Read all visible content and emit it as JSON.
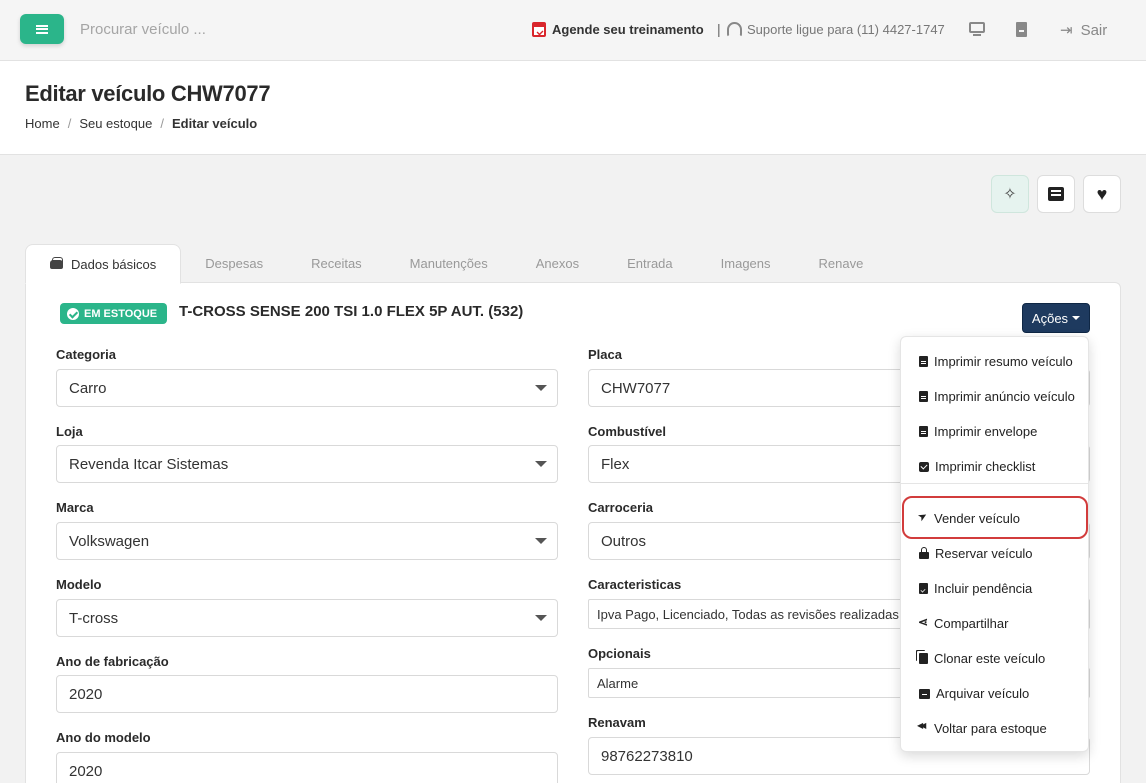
{
  "topbar": {
    "search_placeholder": "Procurar veículo ...",
    "training_label": "Agende seu treinamento",
    "separator": "|",
    "support_label": "Suporte ligue para (11) 4427-1747",
    "logout_label": "Sair"
  },
  "header": {
    "title": "Editar veículo CHW7077",
    "breadcrumb": [
      "Home",
      "Seu estoque",
      "Editar veículo"
    ],
    "breadcrumb_separator": "/"
  },
  "tabs": [
    "Dados básicos",
    "Despesas",
    "Receitas",
    "Manutenções",
    "Anexos",
    "Entrada",
    "Imagens",
    "Renave"
  ],
  "vehicle": {
    "status_badge": "EM ESTOQUE",
    "title": "T-CROSS SENSE 200 TSI 1.0 FLEX 5P AUT. (532)"
  },
  "actions_button": "Ações",
  "form": {
    "left": [
      {
        "label": "Categoria",
        "value": "Carro"
      },
      {
        "label": "Loja",
        "value": "Revenda Itcar Sistemas"
      },
      {
        "label": "Marca",
        "value": "Volkswagen"
      },
      {
        "label": "Modelo",
        "value": "T-cross"
      },
      {
        "label": "Ano de fabricação",
        "value": "2020"
      },
      {
        "label": "Ano do modelo",
        "value": "2020"
      }
    ],
    "right": [
      {
        "label": "Placa",
        "value": "CHW7077"
      },
      {
        "label": "Combustível",
        "value": "Flex"
      },
      {
        "label": "Carroceria",
        "value": "Outros"
      },
      {
        "label": "Caracteristicas",
        "value": "Ipva Pago, Licenciado, Todas as revisões realizadas"
      },
      {
        "label": "Opcionais",
        "value": "Alarme"
      },
      {
        "label": "Renavam",
        "value": "98762273810"
      }
    ]
  },
  "actions_menu": [
    "Imprimir resumo veículo",
    "Imprimir anúncio veículo",
    "Imprimir envelope",
    "Imprimir checklist",
    "Vender veículo",
    "Reservar veículo",
    "Incluir pendência",
    "Compartilhar",
    "Clonar este veículo",
    "Arquivar veículo",
    "Voltar para estoque"
  ],
  "colors": {
    "brand_green": "#2bb58a",
    "actions_navy": "#1e3a5f",
    "highlight_red": "#d23c3c",
    "calendar_red": "#d9262c"
  },
  "icons": [
    "menu-icon",
    "calendar-icon",
    "headset-icon",
    "monitor-icon",
    "file-icon",
    "logout-icon",
    "sparkle-icon",
    "list-icon",
    "heart-icon",
    "car-icon",
    "check-circle-icon"
  ]
}
